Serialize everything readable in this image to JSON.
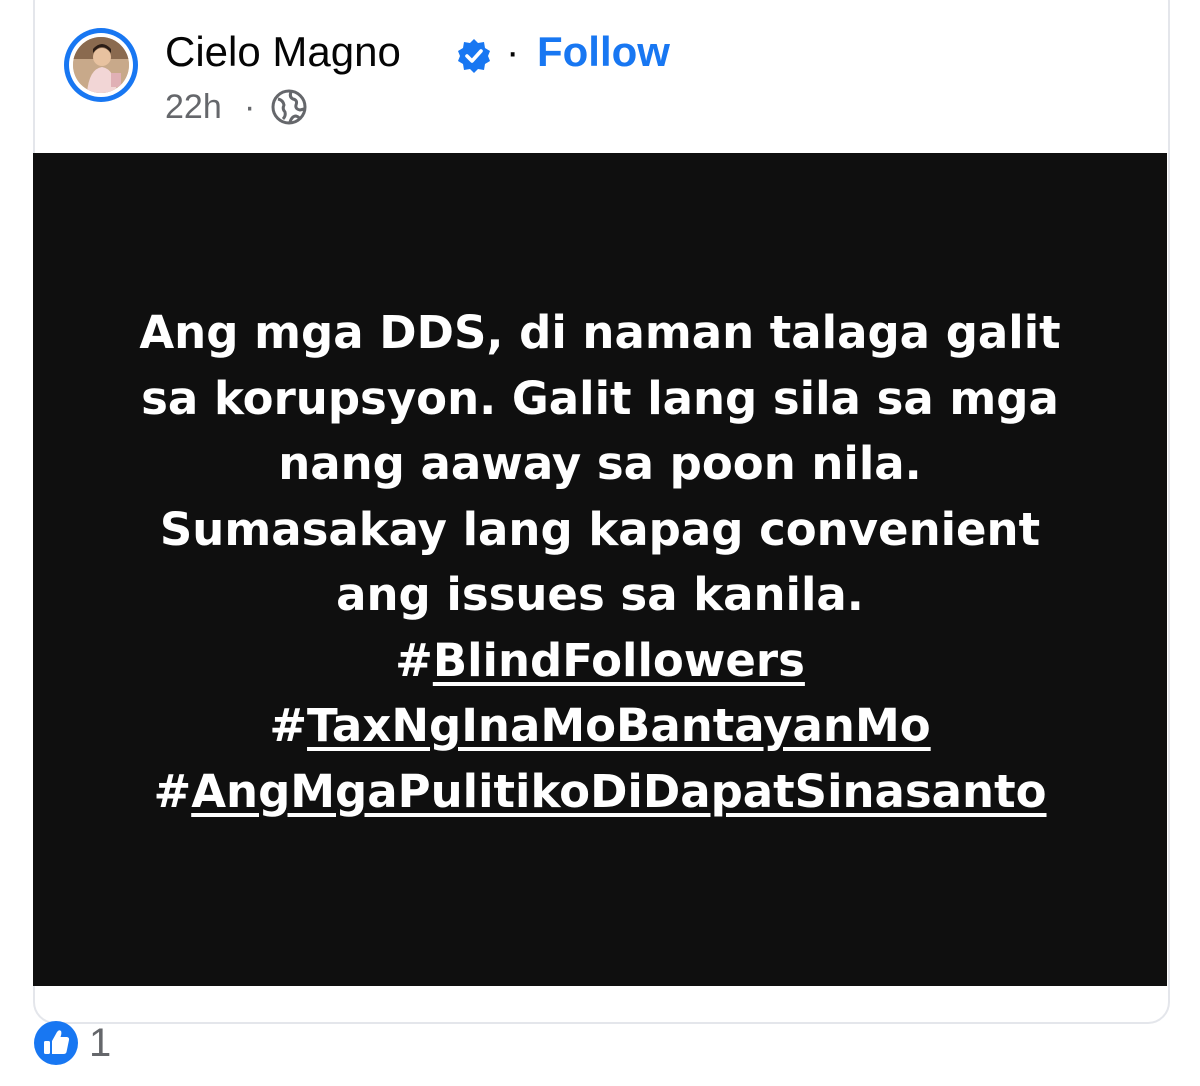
{
  "post": {
    "author": "Cielo Magno",
    "separator": "·",
    "follow_label": "Follow",
    "timestamp": "22h",
    "timestamp_separator": "·",
    "audience_icon": "globe-icon",
    "verified_icon": "verified-badge-icon"
  },
  "image_text": {
    "lines": [
      "Ang mga DDS, di naman talaga galit",
      "sa korupsyon. Galit lang sila sa mga",
      "nang aaway sa poon nila.",
      "Sumasakay lang kapag convenient",
      "ang issues sa kanila."
    ],
    "hashtags": [
      "BlindFollowers",
      "TaxNgInaMoBantayanMo",
      "AngMgaPulitikoDiDapatSinasanto"
    ],
    "hash_symbol": "#"
  },
  "reactions": {
    "icon": "like-icon",
    "count": "1"
  },
  "colors": {
    "accent": "#1877f2",
    "image_background": "#0f0f0f",
    "secondary_text": "#65676b"
  }
}
